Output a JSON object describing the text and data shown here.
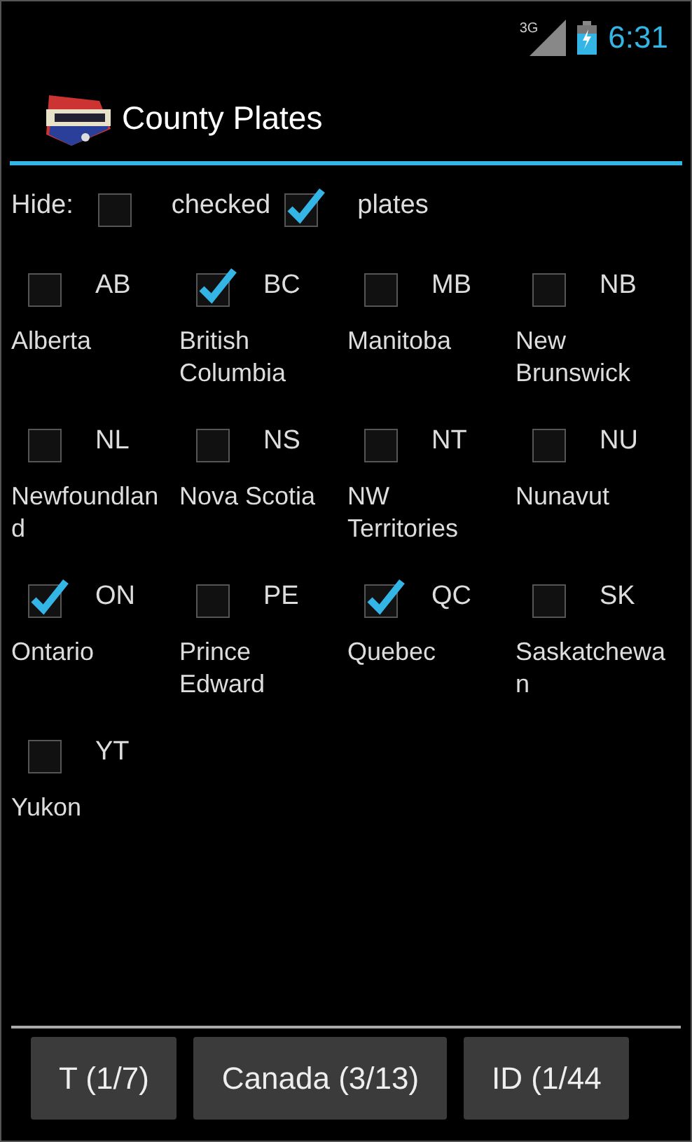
{
  "status_bar": {
    "network": "3G",
    "time": "6:31"
  },
  "action_bar": {
    "title": "County Plates"
  },
  "hide_row": {
    "label": "Hide:",
    "options": [
      {
        "label": "checked",
        "checked": false
      },
      {
        "label": "plates",
        "checked": true
      }
    ]
  },
  "provinces": [
    {
      "code": "AB",
      "name": "Alberta",
      "checked": false
    },
    {
      "code": "BC",
      "name": "British Columbia",
      "checked": true
    },
    {
      "code": "MB",
      "name": "Manitoba",
      "checked": false
    },
    {
      "code": "NB",
      "name": "New Brunswick",
      "checked": false
    },
    {
      "code": "NL",
      "name": "Newfoundland",
      "checked": false
    },
    {
      "code": "NS",
      "name": "Nova Scotia",
      "checked": false
    },
    {
      "code": "NT",
      "name": "NW Territories",
      "checked": false
    },
    {
      "code": "NU",
      "name": "Nunavut",
      "checked": false
    },
    {
      "code": "ON",
      "name": "Ontario",
      "checked": true
    },
    {
      "code": "PE",
      "name": "Prince Edward",
      "checked": false
    },
    {
      "code": "QC",
      "name": "Quebec",
      "checked": true
    },
    {
      "code": "SK",
      "name": "Saskatchewan",
      "checked": false
    },
    {
      "code": "YT",
      "name": "Yukon",
      "checked": false
    }
  ],
  "tabs": [
    "T (1/7)",
    "Canada (3/13)",
    "ID (1/44"
  ]
}
